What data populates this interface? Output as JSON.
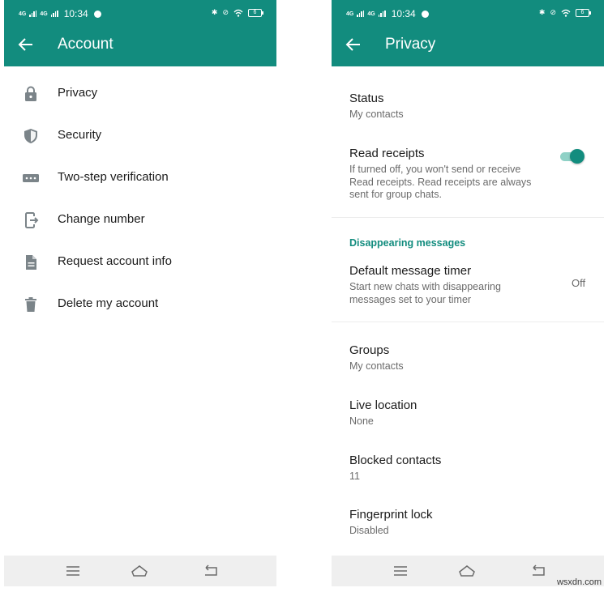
{
  "status_bar": {
    "network1": "4G",
    "network2": "4G",
    "time": "10:34",
    "battery": "6"
  },
  "account": {
    "title": "Account",
    "items": [
      {
        "label": "Privacy",
        "icon": "lock-icon"
      },
      {
        "label": "Security",
        "icon": "shield-icon"
      },
      {
        "label": "Two-step verification",
        "icon": "dots-icon"
      },
      {
        "label": "Change number",
        "icon": "phone-change-icon"
      },
      {
        "label": "Request account info",
        "icon": "document-icon"
      },
      {
        "label": "Delete my account",
        "icon": "trash-icon"
      }
    ]
  },
  "privacy": {
    "title": "Privacy",
    "status": {
      "label": "Status",
      "value": "My contacts"
    },
    "read_receipts": {
      "label": "Read receipts",
      "description": "If turned off, you won't send or receive Read receipts. Read receipts are always sent for group chats.",
      "enabled": true
    },
    "disappearing_section": "Disappearing messages",
    "default_timer": {
      "label": "Default message timer",
      "description": "Start new chats with disappearing messages set to your timer",
      "value": "Off"
    },
    "groups": {
      "label": "Groups",
      "value": "My contacts"
    },
    "live_location": {
      "label": "Live location",
      "value": "None"
    },
    "blocked_contacts": {
      "label": "Blocked contacts",
      "value": "11"
    },
    "fingerprint_lock": {
      "label": "Fingerprint lock",
      "value": "Disabled"
    }
  },
  "watermark": "wsxdn.com",
  "colors": {
    "brand": "#128C7E",
    "toggle_track": "#8fd1c6",
    "icon": "#7b8489"
  }
}
